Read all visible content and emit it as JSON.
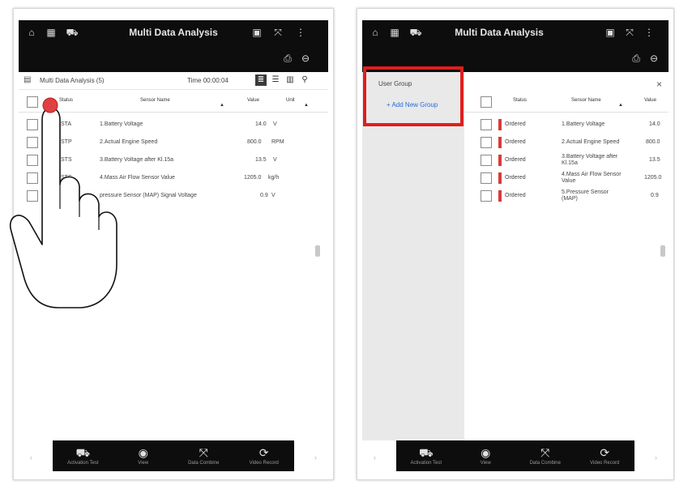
{
  "left": {
    "topbar": {
      "title": "Multi Data Analysis",
      "icons": [
        "home-icon",
        "vci-icon",
        "car-icon",
        "screen-icon",
        "expand-icon",
        "more-icon",
        "print-icon",
        "exit-icon"
      ]
    },
    "subheader": {
      "title": "Multi Data Analysis (5)",
      "time": "Time 00:00:04"
    },
    "columns": {
      "status": "Status",
      "sensor_name": "Sensor Name",
      "value": "Value",
      "unit": "Unit"
    },
    "rows": [
      {
        "status": "STA",
        "name": "1.Battery Voltage",
        "value": "14.0",
        "unit": "V"
      },
      {
        "status": "STP",
        "name": "2.Actual Engine Speed",
        "value": "800.0",
        "unit": "RPM"
      },
      {
        "status": "STS",
        "name": "3.Battery Voltage after Kl.15a",
        "value": "13.5",
        "unit": "V"
      },
      {
        "status": "STS",
        "name": "4.Mass Air Flow Sensor Value",
        "value": "1205.0",
        "unit": "kg/h"
      },
      {
        "status": "",
        "name": "pressure Sensor (MAP) Signal Voltage",
        "value": "0.9",
        "unit": "V"
      }
    ],
    "bottombar": [
      {
        "icon": "car-icon",
        "label": "Activation Test"
      },
      {
        "icon": "eye-icon",
        "label": "View"
      },
      {
        "icon": "expand-icon",
        "label": "Data Combine"
      },
      {
        "icon": "rotate-icon",
        "label": "Video Record"
      }
    ]
  },
  "right": {
    "topbar": {
      "title": "Multi Data Analysis"
    },
    "user_group": {
      "title": "User Group",
      "add_button": "+ Add New Group"
    },
    "close": "×",
    "columns": {
      "status": "Status",
      "sensor_name": "Sensor Name",
      "value": "Value"
    },
    "rows": [
      {
        "status": "Ordered",
        "name": "1.Battery Voltage",
        "value": "14.0"
      },
      {
        "status": "Ordered",
        "name": "2.Actual Engine Speed",
        "value": "800.0"
      },
      {
        "status": "Ordered",
        "name": "3.Battery Voltage after Kl.15a",
        "value": "13.5"
      },
      {
        "status": "Ordered",
        "name": "4.Mass Air Flow Sensor Value",
        "value": "1205.0"
      },
      {
        "status": "Ordered",
        "name": "5.Pressure Sensor (MAP)",
        "value": "0.9"
      }
    ],
    "bottombar": [
      {
        "icon": "car-icon",
        "label": "Activation Test"
      },
      {
        "icon": "eye-icon",
        "label": "View"
      },
      {
        "icon": "expand-icon",
        "label": "Data Combine"
      },
      {
        "icon": "rotate-icon",
        "label": "Video Record"
      }
    ]
  },
  "colors": {
    "topbar": "#0d0d0d",
    "highlight": "#e01e1e",
    "touch_point": "#e04040",
    "status_marker": "#d93a3a",
    "add_group_text": "#2a6ad8"
  }
}
